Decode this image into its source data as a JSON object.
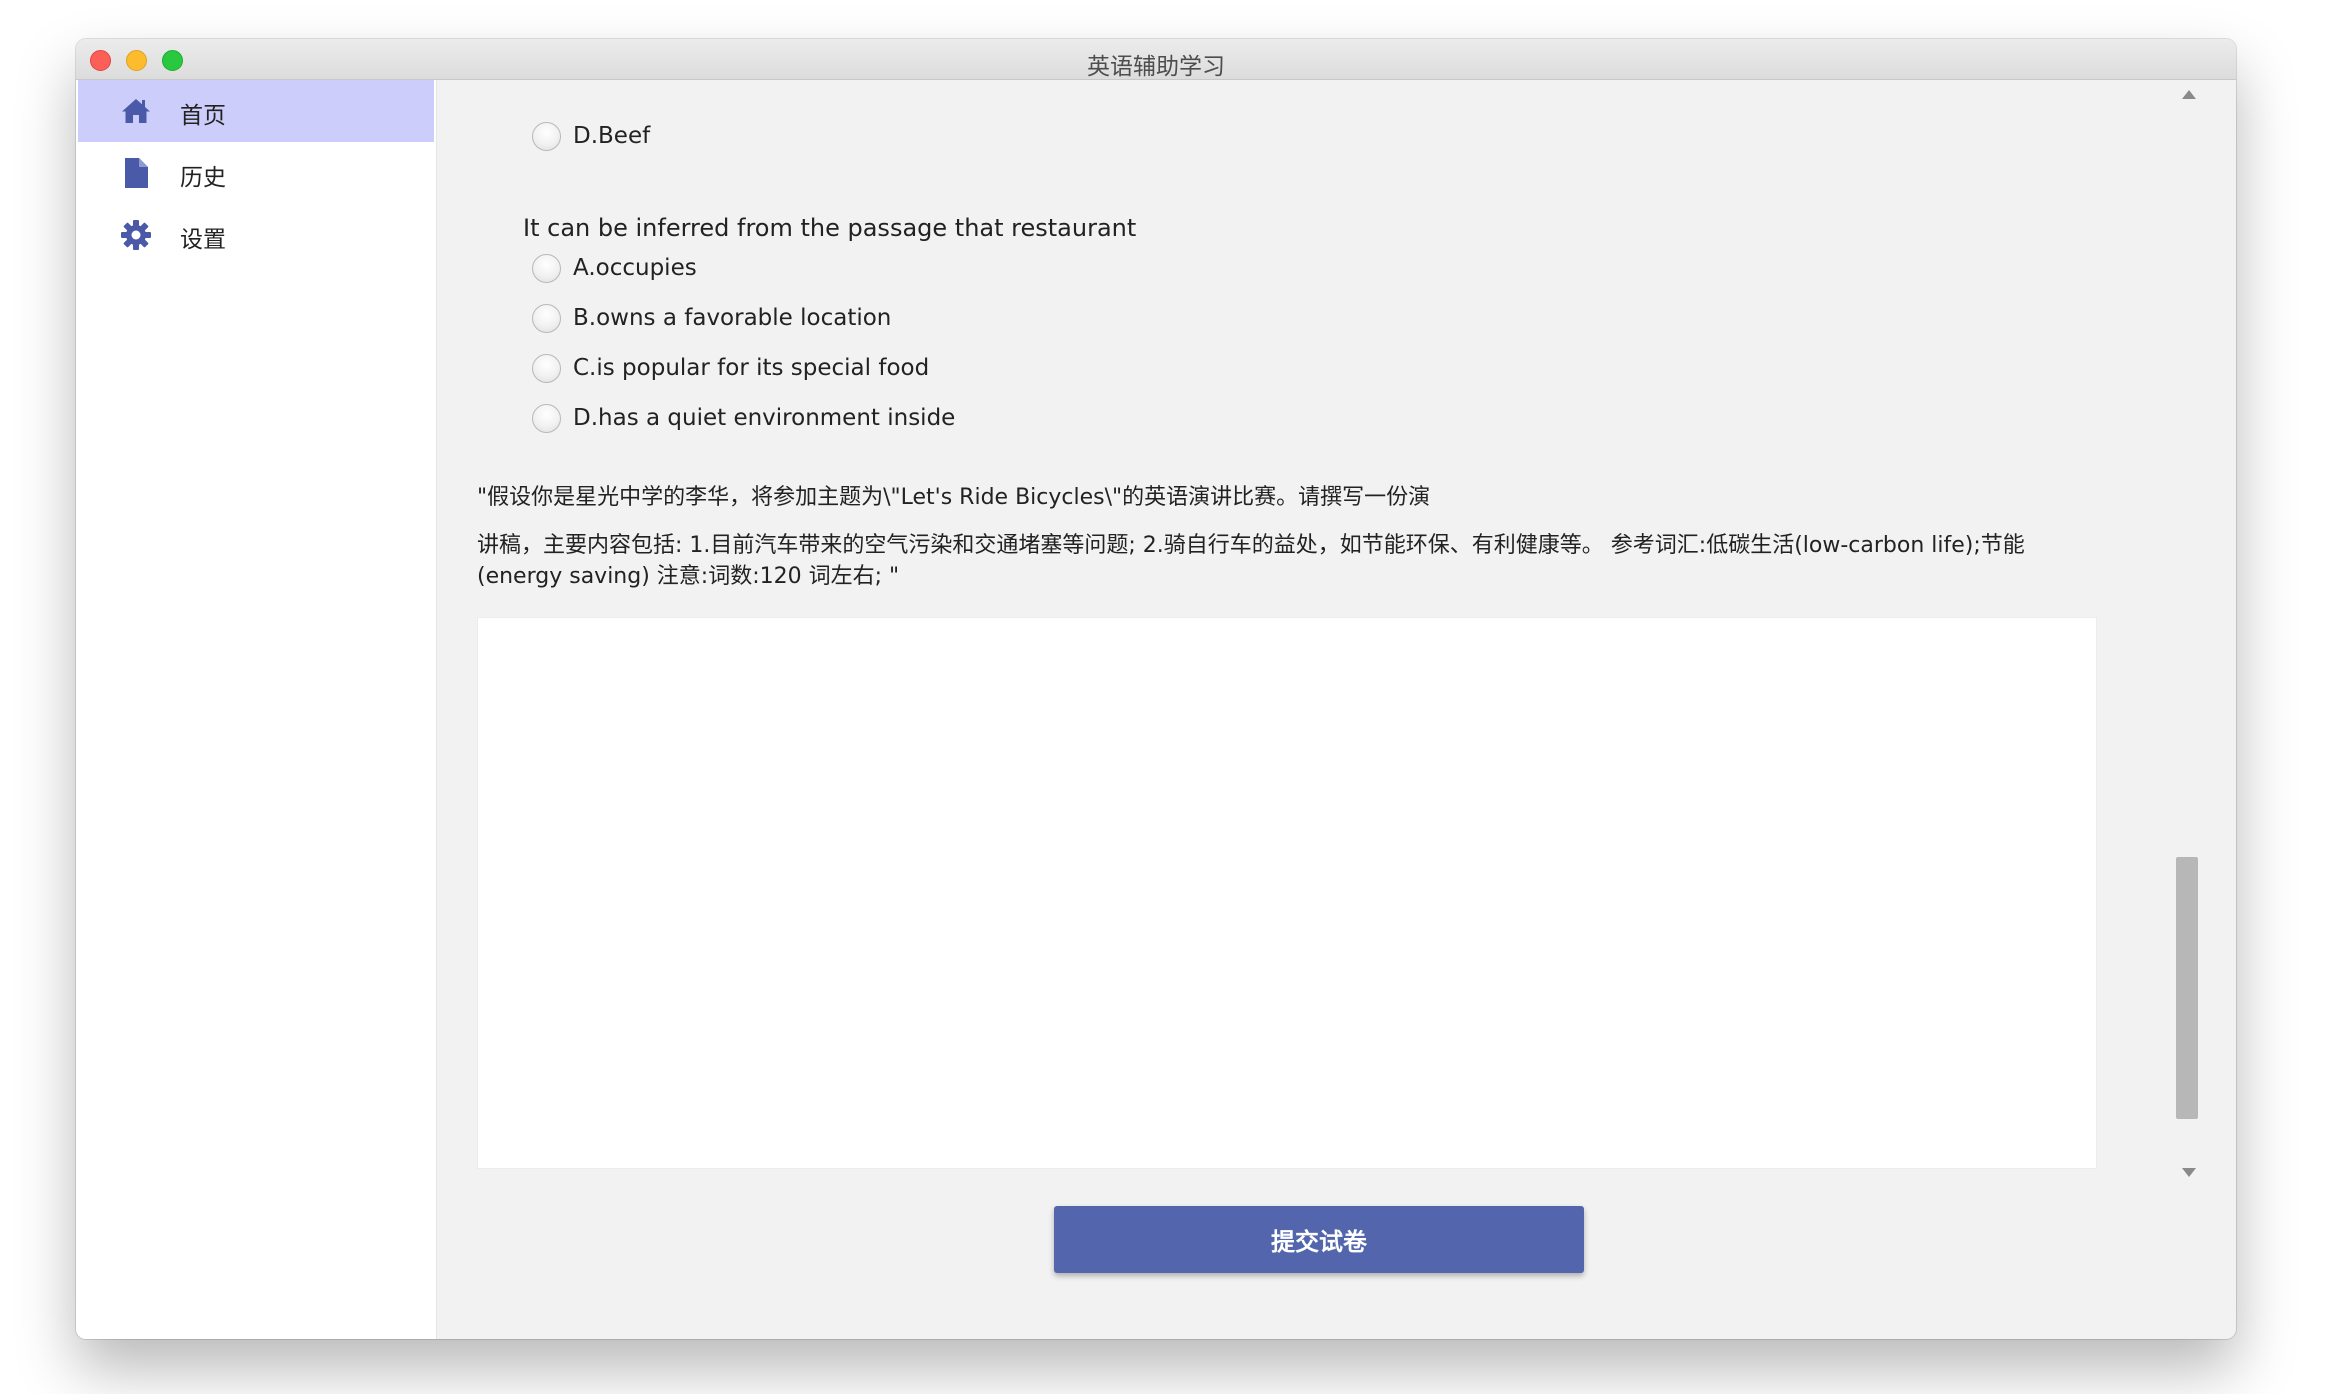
{
  "window": {
    "title": "英语辅助学习"
  },
  "sidebar": {
    "items": [
      {
        "label": "首页",
        "icon": "home-icon",
        "active": true
      },
      {
        "label": "历史",
        "icon": "document-icon",
        "active": false
      },
      {
        "label": "设置",
        "icon": "gear-icon",
        "active": false
      }
    ]
  },
  "quiz": {
    "prev_question": {
      "options": [
        "D.Beef"
      ]
    },
    "question": {
      "text": "It can be inferred from the passage that restaurant",
      "options": [
        "A.occupies",
        "B.owns a favorable location",
        "C.is popular for its special food",
        "D.has a quiet environment inside"
      ]
    },
    "writing": {
      "line1": "\"假设你是星光中学的李华，将参加主题为\\\"Let's Ride Bicycles\\\"的英语演讲比赛。请撰写一份演",
      "line2": "讲稿，主要内容包括: 1.目前汽车带来的空气污染和交通堵塞等问题; 2.骑自行车的益处，如节能环保、有利健康等。 参考词汇:低碳生活(low-carbon life);节能(energy saving) 注意:词数:120 词左右; \"",
      "answer": ""
    },
    "submit_label": "提交试卷"
  },
  "colors": {
    "accent": "#5265ad",
    "active_nav": "#cdcdfb",
    "icon": "#4a5aa8"
  }
}
